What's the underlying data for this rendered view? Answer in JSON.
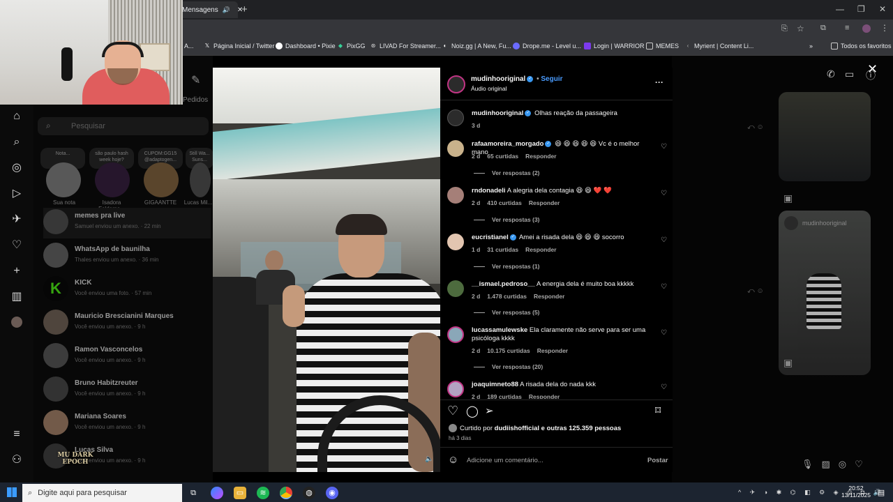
{
  "browser": {
    "tab_title": "Mensagens",
    "bookmarks": [
      {
        "label": "A...",
        "icon": "bookmark-icon"
      },
      {
        "label": "Página Inicial / Twitter",
        "icon": "x-icon"
      },
      {
        "label": "Dashboard • Pixie",
        "icon": "pixie-icon"
      },
      {
        "label": "PixGG",
        "icon": "pixgg-icon"
      },
      {
        "label": "LIVAD For Streamer...",
        "icon": "livad-icon"
      },
      {
        "label": "Noiz.gg | A New, Fu...",
        "icon": "noiz-icon"
      },
      {
        "label": "Drope.me - Level u...",
        "icon": "drope-icon"
      },
      {
        "label": "Login | WARRIOR",
        "icon": "warrior-icon"
      },
      {
        "label": "MEMES",
        "icon": "folder-icon"
      },
      {
        "label": "Myrient | Content Li...",
        "icon": "myrient-icon"
      }
    ],
    "other_bookmarks": "Todos os favoritos"
  },
  "inbox": {
    "search_placeholder": "Pesquisar",
    "pedidos_label": "Pedidos",
    "notes": [
      {
        "bubble": "Nota...",
        "label": "Sua nota"
      },
      {
        "bubble": "são paulo hash week hoje?",
        "label": "Isadora Feldema..."
      },
      {
        "bubble": "CUPOM:GG15 @adaptogen...",
        "label": "GIGAANTTE"
      },
      {
        "bubble": "Still Wa... Suns...",
        "label": "Lucas Mil..."
      }
    ],
    "conversations": [
      {
        "name": "memes pra live",
        "sub": "Samuel enviou um anexo. · 22 min"
      },
      {
        "name": "WhatsApp de baunilha",
        "sub": "Thales enviou um anexo. · 36 min"
      },
      {
        "name": "KICK",
        "sub": "Você enviou uma foto. · 57 min"
      },
      {
        "name": "Mauricio Brescianini Marques",
        "sub": "Você enviou um anexo. · 9 h"
      },
      {
        "name": "Ramon Vasconcelos",
        "sub": "Você enviou um anexo. · 9 h"
      },
      {
        "name": "Bruno Habitzreuter",
        "sub": "Você enviou um anexo. · 9 h"
      },
      {
        "name": "Mariana Soares",
        "sub": "Você enviou um anexo. · 9 h"
      },
      {
        "name": "Lucas Silva",
        "sub": "Você enviou um anexo. · 9 h"
      }
    ]
  },
  "overlay_logo": "MU DARK EPOCH",
  "post": {
    "author": "mudinhooriginal",
    "follow": "Seguir",
    "audio": "Áudio original",
    "caption_user": "mudinhooriginal",
    "caption": "Olhas reação da passageira",
    "caption_age": "3 d",
    "comments": [
      {
        "user": "rafaamoreira_morgado",
        "verified": true,
        "text": "😆 😆 😆 😆 😆 Vc é o melhor mano",
        "age": "2 d",
        "likes": "65 curtidas",
        "reply": "Responder",
        "replies": "Ver respostas (2)"
      },
      {
        "user": "rndonadeli",
        "verified": false,
        "text": "A alegria dela contagia 😆 😆 ❤️ ❤️",
        "age": "2 d",
        "likes": "410 curtidas",
        "reply": "Responder",
        "replies": "Ver respostas (3)"
      },
      {
        "user": "eucristianel",
        "verified": true,
        "text": "Amei a risada dela 😆 😆 😆 socorro",
        "age": "1 d",
        "likes": "31 curtidas",
        "reply": "Responder",
        "replies": "Ver respostas (1)"
      },
      {
        "user": "__ismael.pedroso__",
        "verified": false,
        "text": "A energia dela é muito boa kkkkk",
        "age": "2 d",
        "likes": "1.478 curtidas",
        "reply": "Responder",
        "replies": "Ver respostas (5)"
      },
      {
        "user": "lucassamulewske",
        "verified": false,
        "text": "Ela claramente não serve para ser uma psicóloga kkkk",
        "age": "2 d",
        "likes": "10.175 curtidas",
        "reply": "Responder",
        "replies": "Ver respostas (20)"
      },
      {
        "user": "joaquimneto88",
        "verified": false,
        "text": "A risada dela do nada kkk",
        "age": "2 d",
        "likes": "189 curtidas",
        "reply": "Responder",
        "replies": ""
      }
    ],
    "liked_by_prefix": "Curtido por",
    "liked_by_user": "dudiishofficial",
    "liked_by_rest": "e outras 125.359 pessoas",
    "post_age": "há 3 dias",
    "comment_placeholder": "Adicione um comentário...",
    "post_button": "Postar"
  },
  "chat_preview": {
    "shared_user": "mudinhooriginal"
  },
  "taskbar": {
    "search_placeholder": "Digite aqui para pesquisar",
    "time": "20:52",
    "date": "13/11/2025"
  }
}
